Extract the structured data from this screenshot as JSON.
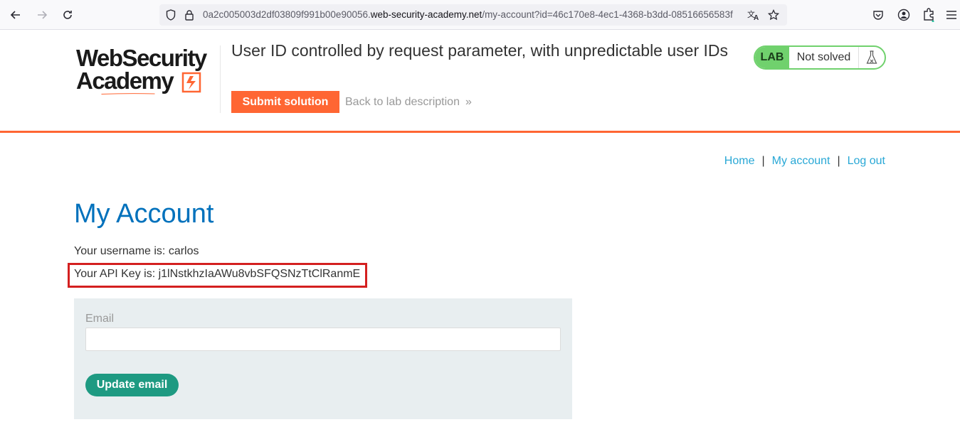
{
  "browser": {
    "url_prefix": "0a2c005003d2df03809f991b00e90056.",
    "url_domain": "web-security-academy.net",
    "url_path": "/my-account?id=46c170e8-4ec1-4368-b3dd-08516656583f",
    "icons": [
      "back-arrow-icon",
      "forward-arrow-icon",
      "reload-icon",
      "shield-icon",
      "lock-icon",
      "translate-icon",
      "star-icon",
      "pocket-icon",
      "account-icon",
      "extensions-icon",
      "menu-icon"
    ]
  },
  "lab_header": {
    "logo_line1": "WebSecurity",
    "logo_line2": "Academy",
    "title": "User ID controlled by request parameter, with unpredictable user IDs",
    "submit_label": "Submit solution",
    "back_label": "Back to lab description",
    "back_chevron": "»",
    "lab_badge": "LAB",
    "lab_status": "Not solved",
    "accent_color": "#ff6633",
    "status_color": "#70d16d"
  },
  "nav": {
    "home": "Home",
    "separator": "|",
    "my_account": "My account",
    "log_out": "Log out"
  },
  "account": {
    "title": "My Account",
    "username_line": "Your username is: carlos",
    "apikey_line": "Your API Key is: j1lNstkhzIaAWu8vbSFQSNzTtClRanmE"
  },
  "email_form": {
    "label": "Email",
    "value": "",
    "button_label": "Update email"
  }
}
